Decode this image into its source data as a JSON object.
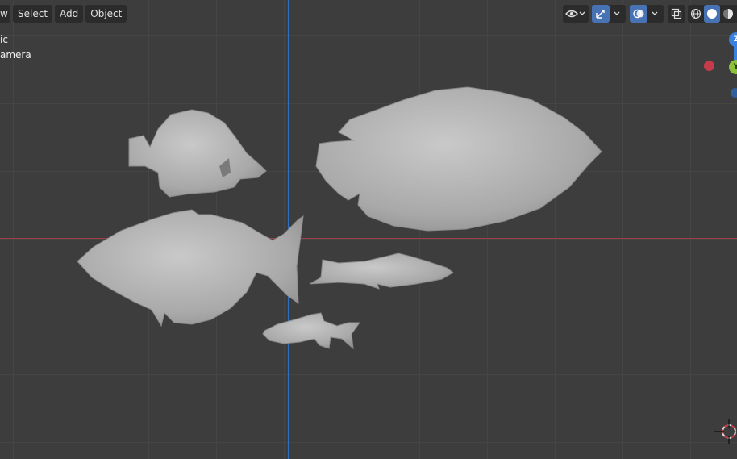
{
  "header": {
    "menu": {
      "view_label": "w",
      "select_label": "Select",
      "add_label": "Add",
      "object_label": "Object"
    }
  },
  "viewport": {
    "info_line1": "ic",
    "info_line2": "amera"
  },
  "gizmo": {
    "z_label": "Z",
    "y_label": "Y"
  },
  "colors": {
    "axis_x": "#a13e46",
    "axis_z": "#2f6fbf",
    "accent_blue": "#4772b3",
    "gizmo_x": "#c43c4a",
    "gizmo_y": "#8bc23a",
    "gizmo_z": "#3a80df"
  },
  "icons": {
    "visibility": "eye-icon",
    "gizmo_toggle": "gizmo-icon",
    "overlays": "overlay-icon",
    "xray": "xray-icon",
    "wireframe": "wireframe-shading-icon",
    "solid": "solid-shading-icon",
    "material": "material-shading-icon",
    "cursor": "3d-cursor-icon"
  }
}
